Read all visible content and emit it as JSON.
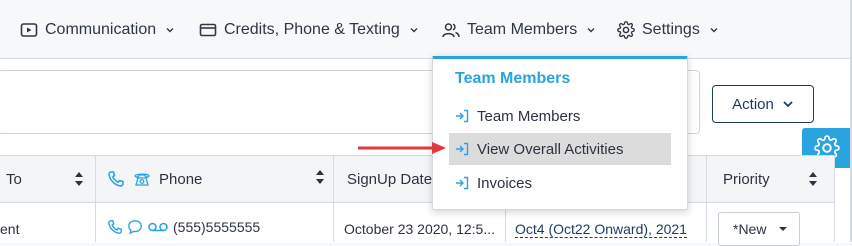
{
  "nav": {
    "items": [
      {
        "label": "Communication"
      },
      {
        "label": "Credits, Phone & Texting"
      },
      {
        "label": "Team Members"
      },
      {
        "label": "Settings"
      }
    ]
  },
  "action": {
    "label": "Action"
  },
  "dropdown": {
    "title": "Team Members",
    "items": [
      {
        "label": "Team Members"
      },
      {
        "label": "View Overall Activities",
        "highlighted": true
      },
      {
        "label": "Invoices"
      }
    ]
  },
  "table": {
    "headers": [
      "To",
      "Phone",
      "SignUp Date",
      "Priority"
    ],
    "row": {
      "to": "ent",
      "phone": "(555)5555555",
      "signup": "October 23 2020, 12:5...",
      "week": "Oct4 (Oct22 Onward), 2021",
      "priority": "*New"
    }
  },
  "colors": {
    "accent": "#2aa4de",
    "navy": "#1f3b64",
    "arrow": "#e0393e"
  }
}
